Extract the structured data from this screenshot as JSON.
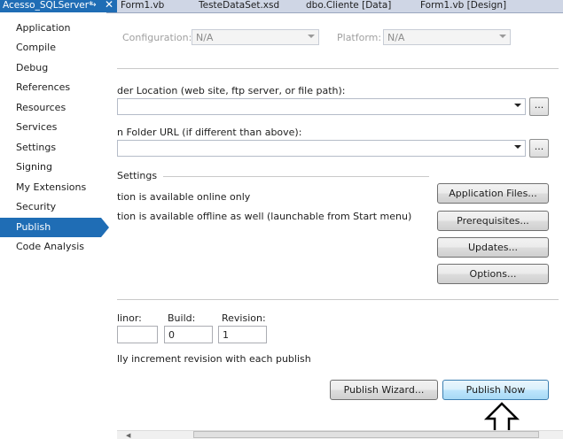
{
  "tabs": {
    "active": {
      "label": "Acesso_SQLServer*",
      "pin": "→",
      "close": "✕"
    },
    "others": [
      "Form1.vb",
      "TesteDataSet.xsd",
      "dbo.Cliente [Data]",
      "Form1.vb [Design]"
    ]
  },
  "sidebar": {
    "items": [
      {
        "label": "Application"
      },
      {
        "label": "Compile"
      },
      {
        "label": "Debug"
      },
      {
        "label": "References"
      },
      {
        "label": "Resources"
      },
      {
        "label": "Services"
      },
      {
        "label": "Settings"
      },
      {
        "label": "Signing"
      },
      {
        "label": "My Extensions"
      },
      {
        "label": "Security"
      },
      {
        "label": "Publish",
        "active": true
      },
      {
        "label": "Code Analysis"
      }
    ]
  },
  "config": {
    "configuration_label": "Configuration:",
    "configuration_value": "N/A",
    "platform_label": "Platform:",
    "platform_value": "N/A"
  },
  "publish": {
    "folder_location_label": "der Location (web site, ftp server, or file path):",
    "folder_location_value": "",
    "browse_label": "...",
    "folder_url_label": "n Folder URL (if different than above):",
    "folder_url_value": "",
    "browse2_label": "..."
  },
  "install": {
    "section_label": "Settings",
    "option_online": "tion is available online only",
    "option_offline": "tion is available offline as well (launchable from Start menu)",
    "application_files_button": "Application Files...",
    "prerequisites_button": "Prerequisites...",
    "updates_button": "Updates...",
    "options_button": "Options..."
  },
  "version": {
    "minor_label": "linor:",
    "minor_value": "",
    "build_label": "Build:",
    "build_value": "0",
    "revision_label": "Revision:",
    "revision_value": "1",
    "auto_increment_label": "lly increment revision with each publish"
  },
  "actions": {
    "wizard_button": "Publish Wizard...",
    "publish_now_button": "Publish Now"
  },
  "icons": {
    "pointer": "up-arrow-outline-icon",
    "dropdown": "chevron-down-icon"
  },
  "colors": {
    "accent": "#1f6db5",
    "tabbar": "#cfd6e5"
  }
}
